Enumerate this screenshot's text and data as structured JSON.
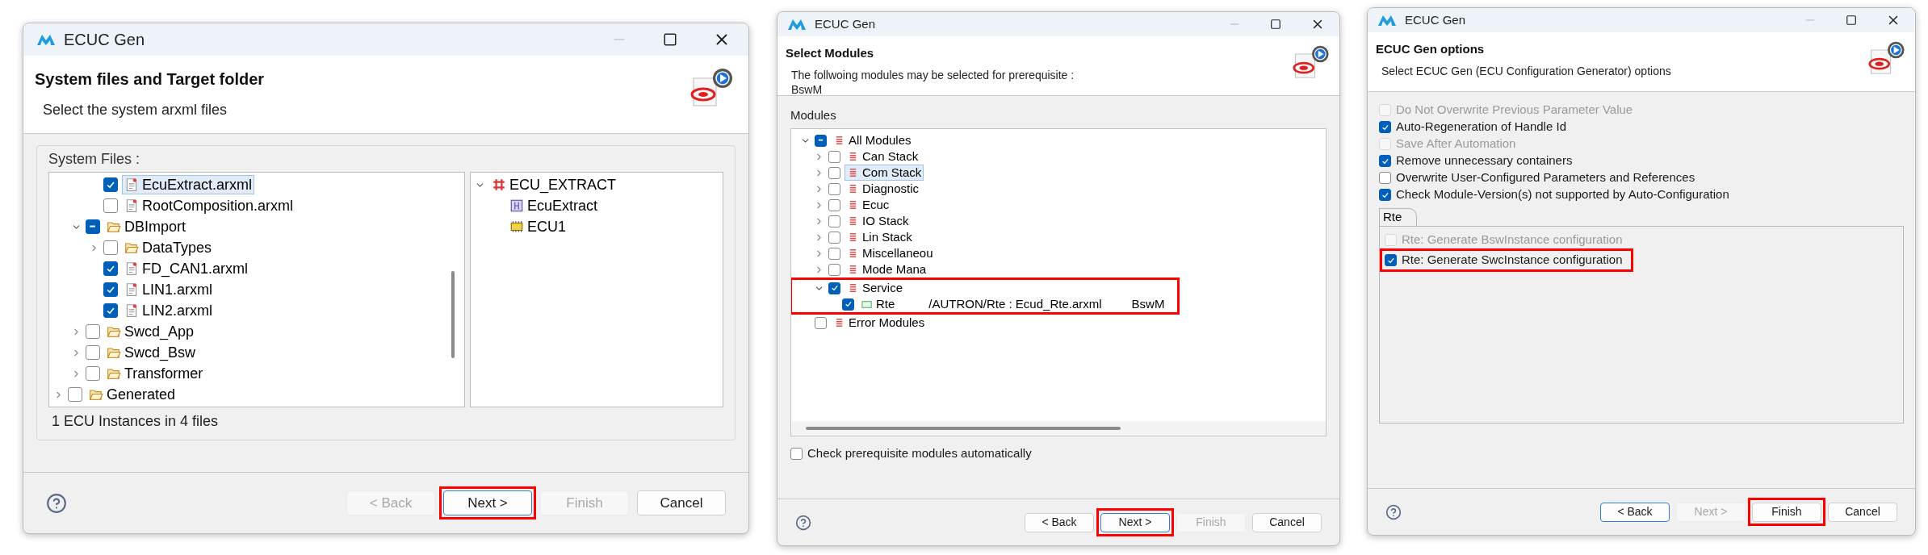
{
  "dialogs": [
    {
      "kind": "files",
      "title": "ECUC Gen",
      "heading": "System files and Target folder",
      "description": [
        "Select the system arxml files"
      ],
      "group_label": "System Files :",
      "files_tree": [
        {
          "children": [
            {
              "children": [
                {
                  "label": "EcuExtract.arxml",
                  "kind": "file",
                  "checked": true,
                  "mixed": false,
                  "selected": true
                },
                {
                  "label": "RootComposition.arxml",
                  "kind": "file",
                  "checked": false,
                  "mixed": false,
                  "selected": false
                }
              ]
            },
            {
              "label": "DBImport",
              "kind": "folder",
              "expanded": true,
              "mixed": true,
              "selected": false,
              "children": [
                {
                  "label": "DataTypes",
                  "kind": "folder",
                  "expanded": false,
                  "checked": false,
                  "mixed": false,
                  "selected": false
                },
                {
                  "label": "FD_CAN1.arxml",
                  "kind": "file",
                  "checked": true,
                  "mixed": false,
                  "selected": false
                },
                {
                  "label": "LIN1.arxml",
                  "kind": "file",
                  "checked": true,
                  "mixed": false,
                  "selected": false
                },
                {
                  "label": "LIN2.arxml",
                  "kind": "file",
                  "checked": true,
                  "mixed": false,
                  "selected": false
                }
              ]
            },
            {
              "label": "Swcd_App",
              "kind": "folder",
              "expanded": false,
              "checked": false,
              "mixed": false,
              "selected": false
            },
            {
              "label": "Swcd_Bsw",
              "kind": "folder",
              "expanded": false,
              "checked": false,
              "mixed": false,
              "selected": false
            },
            {
              "label": "Transformer",
              "kind": "folder",
              "expanded": false,
              "checked": false,
              "mixed": false,
              "selected": false
            }
          ]
        },
        {
          "label": "Generated",
          "kind": "folder",
          "expanded": false,
          "checked": false,
          "mixed": false,
          "selected": false
        }
      ],
      "ecu_tree": [
        {
          "label": "ECU_EXTRACT",
          "kind": "extract-root",
          "expanded": true,
          "selected": false,
          "children": [
            {
              "label": "EcuExtract",
              "kind": "extract",
              "selected": false
            },
            {
              "label": "ECU1",
              "kind": "ecu",
              "selected": false
            }
          ]
        }
      ],
      "status": "1 ECU Instances in 4 files",
      "buttons": [
        {
          "label": "< Back",
          "disabled": true,
          "default": false,
          "highlighted": false
        },
        {
          "label": "Next >",
          "disabled": false,
          "default": true,
          "highlighted": true
        },
        {
          "label": "Finish",
          "disabled": true,
          "default": false,
          "highlighted": false
        },
        {
          "label": "Cancel",
          "disabled": false,
          "default": false,
          "highlighted": false
        }
      ]
    },
    {
      "kind": "modules",
      "title": "ECUC Gen",
      "heading": "Select Modules",
      "description": [
        "The follwoing modules may be selected for prerequisite :",
        "BswM"
      ],
      "group_label": "Modules",
      "modules_tree": [
        {
          "label": "All Modules",
          "kind": "module",
          "expanded": true,
          "mixed": true,
          "selected": false,
          "highlighted": false,
          "children": [
            {
              "label": "Can Stack",
              "kind": "module",
              "expanded": false,
              "checked": false,
              "mixed": false,
              "selected": false,
              "highlighted": false
            },
            {
              "label": "Com Stack",
              "kind": "module",
              "expanded": false,
              "checked": false,
              "mixed": false,
              "selected": true,
              "highlighted": false
            },
            {
              "label": "Diagnostic",
              "kind": "module",
              "expanded": false,
              "checked": false,
              "mixed": false,
              "selected": false,
              "highlighted": false
            },
            {
              "label": "Ecuc",
              "kind": "module",
              "expanded": false,
              "checked": false,
              "mixed": false,
              "selected": false,
              "highlighted": false
            },
            {
              "label": "IO Stack",
              "kind": "module",
              "expanded": false,
              "checked": false,
              "mixed": false,
              "selected": false,
              "highlighted": false
            },
            {
              "label": "Lin Stack",
              "kind": "module",
              "expanded": false,
              "checked": false,
              "mixed": false,
              "selected": false,
              "highlighted": false
            },
            {
              "label": "Miscellaneou",
              "kind": "module",
              "expanded": false,
              "checked": false,
              "mixed": false,
              "selected": false,
              "highlighted": false
            },
            {
              "label": "Mode Mana",
              "kind": "module",
              "expanded": false,
              "checked": false,
              "mixed": false,
              "selected": false,
              "highlighted": false
            },
            {
              "label": "Service",
              "kind": "module",
              "expanded": true,
              "checked": true,
              "mixed": false,
              "selected": false,
              "highlighted": true,
              "children": [
                {
                  "label": "Rte",
                  "kind": "component",
                  "checked": true,
                  "mixed": false,
                  "selected": false,
                  "highlighted": false,
                  "columns": [
                    "/AUTRON/Rte : Ecud_Rte.arxml",
                    "BswM"
                  ]
                }
              ]
            }
          ]
        },
        {
          "label": "Error Modules",
          "kind": "module",
          "checked": false,
          "mixed": false,
          "selected": false,
          "highlighted": false
        }
      ],
      "auto_check": {
        "label": "Check prerequisite modules automatically",
        "checked": false
      },
      "buttons": [
        {
          "label": "< Back",
          "disabled": false,
          "default": false,
          "highlighted": false
        },
        {
          "label": "Next >",
          "disabled": false,
          "default": true,
          "highlighted": true
        },
        {
          "label": "Finish",
          "disabled": true,
          "default": false,
          "highlighted": false
        },
        {
          "label": "Cancel",
          "disabled": false,
          "default": false,
          "highlighted": false
        }
      ]
    },
    {
      "kind": "options",
      "title": "ECUC Gen",
      "heading": "ECUC Gen options",
      "description": [
        "Select ECUC Gen (ECU Configuration Generator) options"
      ],
      "options": [
        {
          "label": "Do Not Overwrite Previous Parameter Value",
          "checked": false,
          "disabled": true,
          "highlighted": false
        },
        {
          "label": "Auto-Regeneration of Handle Id",
          "checked": true,
          "disabled": false,
          "highlighted": false
        },
        {
          "label": "Save After Automation",
          "checked": false,
          "disabled": true,
          "highlighted": false
        },
        {
          "label": "Remove unnecessary containers",
          "checked": true,
          "disabled": false,
          "highlighted": false
        },
        {
          "label": "Overwrite User-Configured Parameters and References",
          "checked": false,
          "disabled": false,
          "highlighted": false
        },
        {
          "label": "Check Module-Version(s) not supported by Auto-Configuration",
          "checked": true,
          "disabled": false,
          "highlighted": false
        }
      ],
      "tabs": [
        {
          "label": "Rte",
          "selected": true
        }
      ],
      "tab_options": [
        {
          "label": "Rte: Generate BswInstance configuration",
          "checked": false,
          "disabled": true,
          "highlighted": false
        },
        {
          "label": "Rte: Generate SwcInstance configuration",
          "checked": true,
          "disabled": false,
          "highlighted": true
        }
      ],
      "buttons": [
        {
          "label": "< Back",
          "disabled": false,
          "default": true,
          "highlighted": false
        },
        {
          "label": "Next >",
          "disabled": true,
          "default": false,
          "highlighted": false
        },
        {
          "label": "Finish",
          "disabled": false,
          "default": false,
          "highlighted": true
        },
        {
          "label": "Cancel",
          "disabled": false,
          "default": false,
          "highlighted": false
        }
      ]
    }
  ]
}
